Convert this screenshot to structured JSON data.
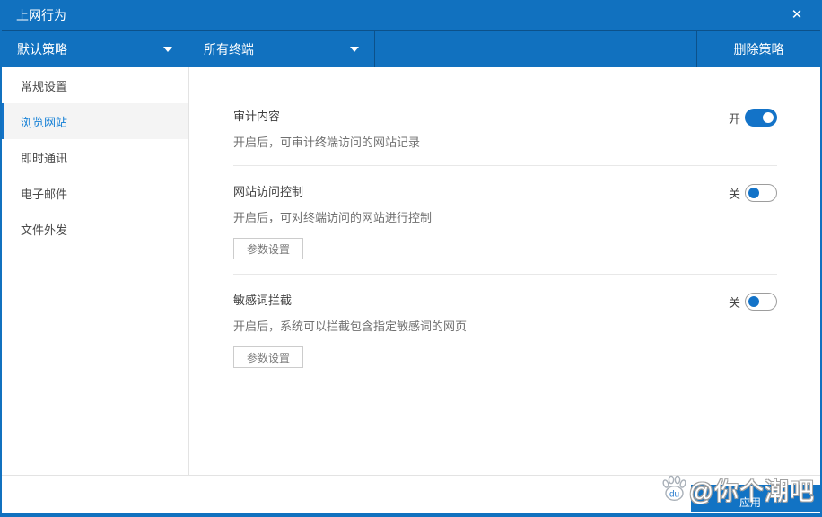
{
  "colors": {
    "bar_blue": "#1171bf",
    "accent_blue": "#1373c8",
    "active_item_text": "#1580d6",
    "active_item_bg": "#f4f4f4",
    "divider_gray": "#e8e8e8",
    "watermark_blue": "#1273c4"
  },
  "titlebar": {
    "title": "上网行为",
    "close_icon": "✕"
  },
  "toolbar": {
    "policy_dropdown": {
      "value": "默认策略"
    },
    "terminal_dropdown": {
      "value": "所有终端"
    },
    "delete_button_label": "删除策略"
  },
  "sidebar": {
    "items": [
      {
        "label": "常规设置",
        "active": false
      },
      {
        "label": "浏览网站",
        "active": true
      },
      {
        "label": "即时通讯",
        "active": false
      },
      {
        "label": "电子邮件",
        "active": false
      },
      {
        "label": "文件外发",
        "active": false
      }
    ]
  },
  "settings": [
    {
      "title": "审计内容",
      "description": "开启后，可审计终端访问的网站记录",
      "toggle": {
        "label": "开",
        "state": "on"
      }
    },
    {
      "title": "网站访问控制",
      "description": "开启后，可对终端访问的网站进行控制",
      "toggle": {
        "label": "关",
        "state": "off"
      },
      "button_label": "参数设置"
    },
    {
      "title": "敏感词拦截",
      "description": "开启后，系统可以拦截包含指定敏感词的网页",
      "toggle": {
        "label": "关",
        "state": "off"
      },
      "button_label": "参数设置"
    }
  ],
  "watermark": {
    "handle": "@你个潮吧",
    "app_label": "应用",
    "paw_icon": "baidu-paw-icon",
    "du_label": "du"
  }
}
